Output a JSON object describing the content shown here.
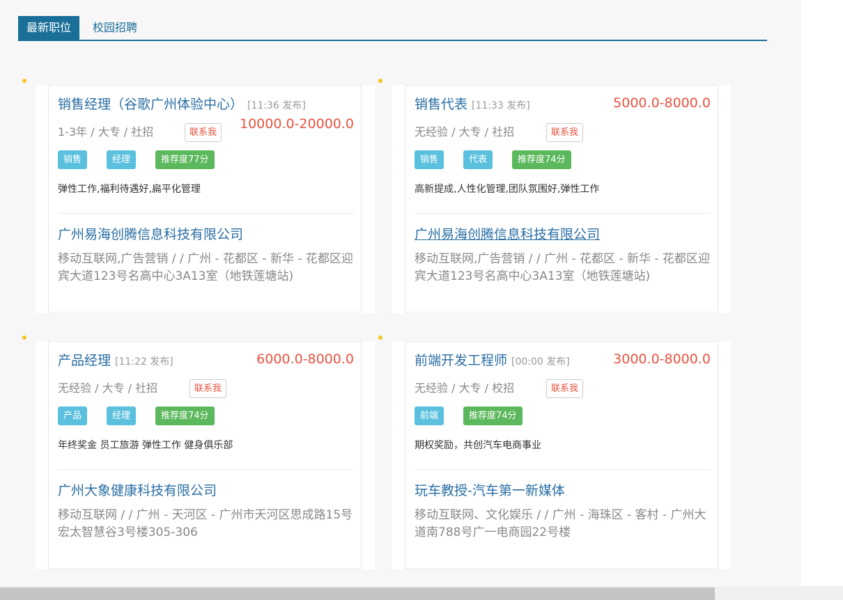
{
  "tabs": {
    "latest": "最新职位",
    "campus": "校园招聘"
  },
  "jobs": [
    {
      "title": "销售经理（谷歌广州体验中心）",
      "time": "[11:36 发布]",
      "salary": "10000.0-20000.0",
      "meta": "1-3年 / 大专 / 社招",
      "contact": "联系我",
      "tags": [
        "销售",
        "经理",
        "推荐度77分"
      ],
      "benefits": "弹性工作,福利待遇好,扁平化管理",
      "company": "广州易海创腾信息科技有限公司",
      "address": "移动互联网,广告营销 / / 广州 - 花都区 - 新华 - 花都区迎宾大道123号名高中心3A13室（地铁莲塘站)"
    },
    {
      "title": "销售代表",
      "time": "[11:33 发布]",
      "salary": "5000.0-8000.0",
      "meta": "无经验 / 大专 / 社招",
      "contact": "联系我",
      "tags": [
        "销售",
        "代表",
        "推荐度74分"
      ],
      "benefits": "高新提成,人性化管理,团队氛围好,弹性工作",
      "company": "广州易海创腾信息科技有限公司",
      "address": "移动互联网,广告营销 / / 广州 - 花都区 - 新华 - 花都区迎宾大道123号名高中心3A13室（地铁莲塘站)"
    },
    {
      "title": "产品经理",
      "time": "[11:22 发布]",
      "salary": "6000.0-8000.0",
      "meta": "无经验 / 大专 / 社招",
      "contact": "联系我",
      "tags": [
        "产品",
        "经理",
        "推荐度74分"
      ],
      "benefits": "年终奖金 员工旅游 弹性工作 健身俱乐部",
      "company": "广州大象健康科技有限公司",
      "address": "移动互联网 / / 广州 - 天河区 - 广州市天河区思成路15号宏太智慧谷3号楼305-306"
    },
    {
      "title": "前端开发工程师",
      "time": "[00:00 发布]",
      "salary": "3000.0-8000.0",
      "meta": "无经验 / 大专 / 校招",
      "contact": "联系我",
      "tags": [
        "前端",
        "推荐度74分"
      ],
      "benefits": "期权奖励，共创汽车电商事业",
      "company": "玩车教授-汽车第一新媒体",
      "address": "移动互联网、文化娱乐 / / 广州 - 海珠区 - 客村 - 广州大道南788号广一电商园22号楼"
    }
  ],
  "colors": {
    "accent": "#1a6f98",
    "link": "#2a6ea3",
    "salary": "#e8523f",
    "tag_blue": "#5bc0de",
    "tag_green": "#5cb85c",
    "dot": "#f5c518"
  }
}
